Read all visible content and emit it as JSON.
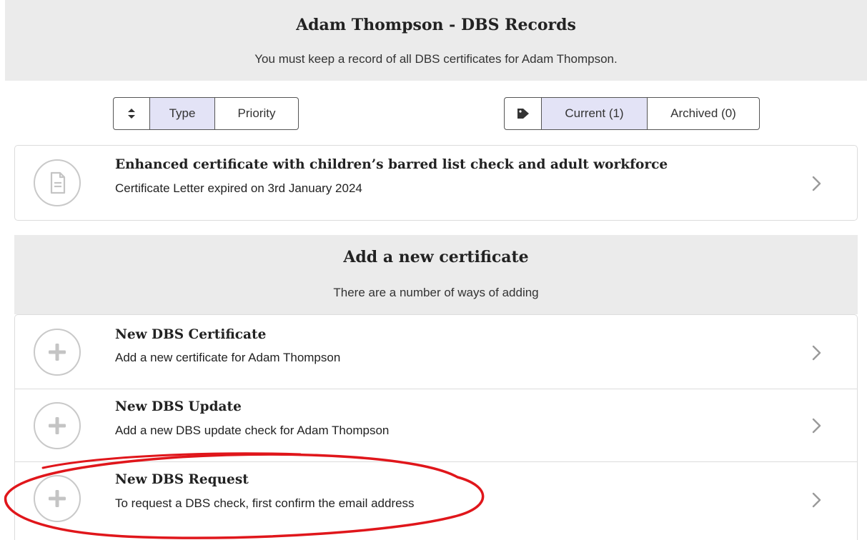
{
  "header": {
    "title": "Adam Thompson - DBS Records",
    "subtitle": "You must keep a record of all DBS certificates for Adam Thompson."
  },
  "sort_control": {
    "icon": "sort-icon",
    "options": [
      "Type",
      "Priority"
    ],
    "selected": "Type"
  },
  "status_control": {
    "icon": "tag-icon",
    "options": [
      "Current (1)",
      "Archived (0)"
    ],
    "selected": "Current (1)"
  },
  "certificates": [
    {
      "icon": "document-icon",
      "title": "Enhanced certificate with children’s barred list check and adult workforce",
      "subtitle": "Certificate Letter expired on 3rd January 2024"
    }
  ],
  "add_section": {
    "title": "Add a new certificate",
    "subtitle": "There are a number of ways of adding",
    "items": [
      {
        "icon": "plus-icon",
        "title": "New DBS Certificate",
        "subtitle": "Add a new certificate for Adam Thompson"
      },
      {
        "icon": "plus-icon",
        "title": "New DBS Update",
        "subtitle": "Add a new DBS update check for Adam Thompson"
      },
      {
        "icon": "plus-icon",
        "title": "New DBS Request",
        "subtitle": "To request a DBS check, first confirm the email address"
      }
    ]
  },
  "colors": {
    "header_bg": "#ebebeb",
    "active_segment": "#e3e3f6",
    "annotation": "#e0161b",
    "icon_grey": "#c9c9c9"
  }
}
